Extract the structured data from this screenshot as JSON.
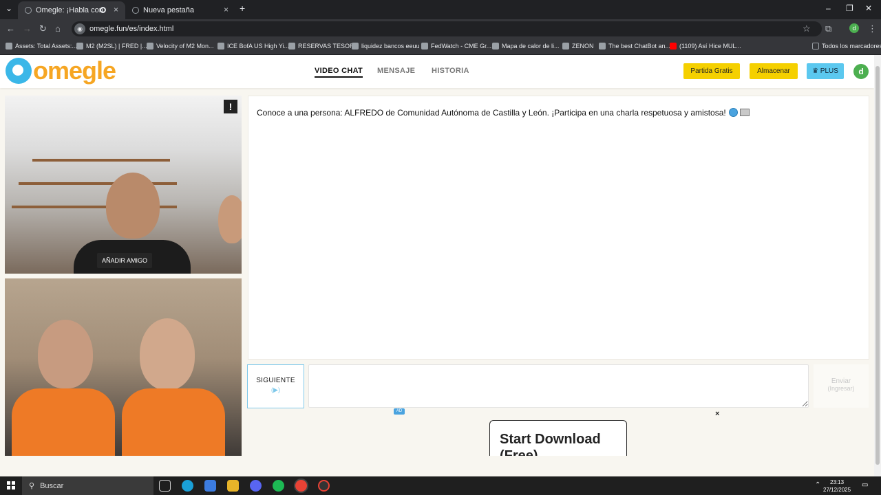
{
  "browser": {
    "tabs": [
      {
        "title": "Omegle: ¡Habla con Descon",
        "active": true
      },
      {
        "title": "Nueva pestaña",
        "active": false
      }
    ],
    "new_tab": "+",
    "url": "omegle.fun/es/index.html",
    "bookmarks": [
      "Assets: Total Assets:...",
      "M2 (M2SL) | FRED |...",
      "Velocity of M2 Mon...",
      "ICE BofA US High Yi...",
      "RESERVAS TESORO",
      "liquidez bancos eeuu",
      "FedWatch - CME Gr...",
      "Mapa de calor de li...",
      "ZENON",
      "The best ChatBot an...",
      "(1109) Así Hice MUL..."
    ],
    "all_bookmarks": "Todos los marcadores",
    "profile_initial": "d"
  },
  "site": {
    "logo_text": "omegle",
    "nav": [
      {
        "label": "VIDEO CHAT",
        "active": true
      },
      {
        "label": "MENSAJE",
        "active": false
      },
      {
        "label": "HISTORIA",
        "active": false
      }
    ],
    "buttons": {
      "free_match": "Partida Gratis",
      "store": "Almacenar",
      "plus": "♛ PLUS"
    },
    "avatar_initial": "d",
    "colors": {
      "brand_orange": "#f6a623",
      "brand_blue": "#3ab7e8",
      "yellow_button": "#f5d000",
      "plus_button": "#5bc8ef"
    }
  },
  "video": {
    "add_friend": "AÑADIR AMIGO",
    "report": "!"
  },
  "chat": {
    "intro": "Conoce a una persona: ALFREDO de Comunidad Autónoma de Castilla y León. ¡Participa en una charla respetuosa y amistosa!",
    "next_label": "SIGUIENTE",
    "next_key": "(▶)",
    "send_label": "Enviar",
    "send_key": "(Ingresar)",
    "message_value": ""
  },
  "ad": {
    "badge": "AD",
    "close": "×",
    "text": "Start Download (Free)"
  },
  "taskbar": {
    "search_placeholder": "Buscar",
    "time": "23:13",
    "date": "27/12/2025"
  }
}
